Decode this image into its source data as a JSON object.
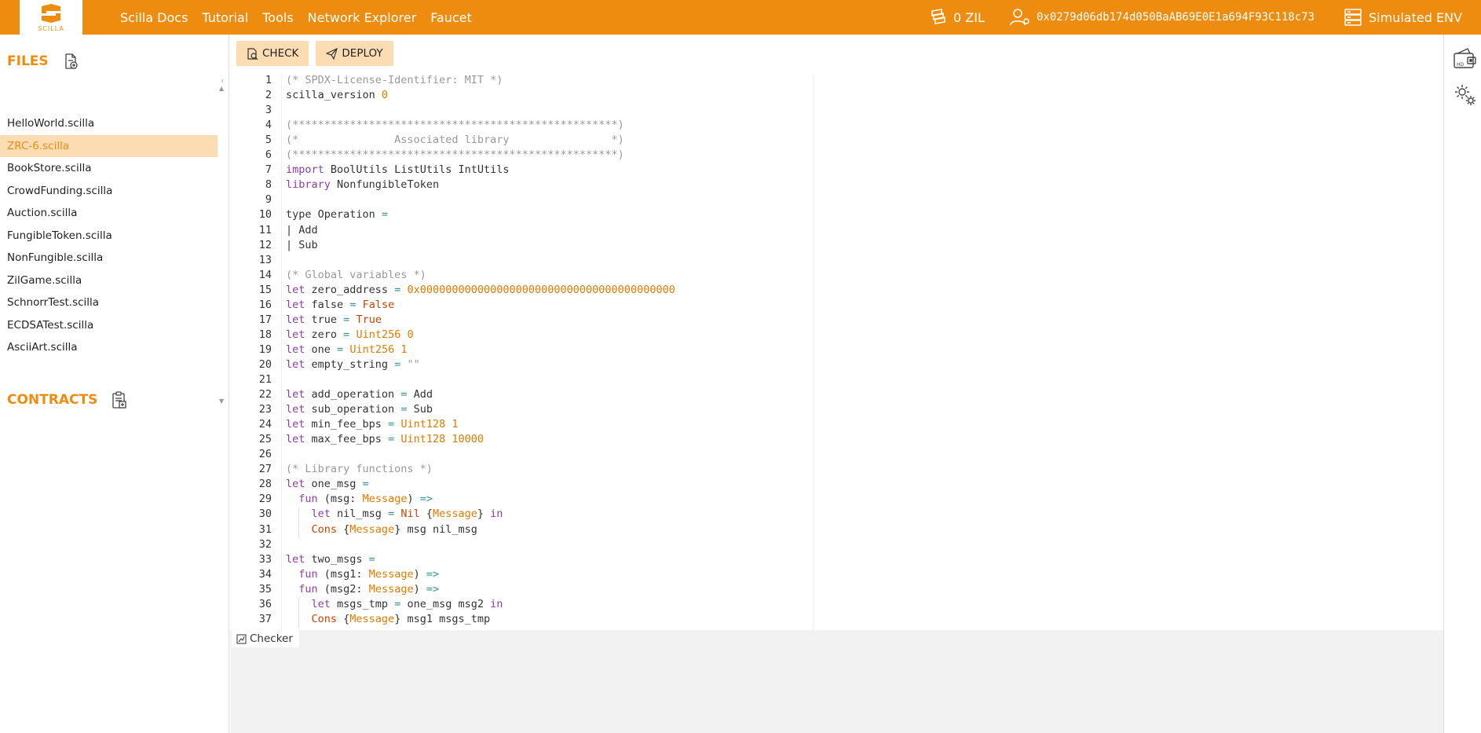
{
  "app": {
    "logo_text": "SCILLA"
  },
  "nav": {
    "items": [
      "Scilla Docs",
      "Tutorial",
      "Tools",
      "Network Explorer",
      "Faucet"
    ]
  },
  "account": {
    "balance": "0 ZIL",
    "address": "0x0279d06db174d050BaAB69E0E1a694F93C118c73",
    "env": "Simulated ENV"
  },
  "files": {
    "title": "FILES",
    "items": [
      "HelloWorld.scilla",
      "ZRC-6.scilla",
      "BookStore.scilla",
      "CrowdFunding.scilla",
      "Auction.scilla",
      "FungibleToken.scilla",
      "NonFungible.scilla",
      "ZilGame.scilla",
      "SchnorrTest.scilla",
      "ECDSATest.scilla",
      "AsciiArt.scilla"
    ],
    "active_index": 1
  },
  "contracts": {
    "title": "CONTRACTS"
  },
  "toolbar": {
    "check_label": "CHECK",
    "deploy_label": "DEPLOY"
  },
  "editor": {
    "line_numbers": [
      "1",
      "2",
      "3",
      "4",
      "5",
      "6",
      "7",
      "8",
      "9",
      "10",
      "11",
      "12",
      "13",
      "14",
      "15",
      "16",
      "17",
      "18",
      "19",
      "20",
      "21",
      "22",
      "23",
      "24",
      "25",
      "26",
      "27",
      "28",
      "29",
      "30",
      "31",
      "32",
      "33",
      "34",
      "35",
      "36",
      "37"
    ],
    "lines": [
      [
        [
          "com",
          "(* SPDX-License-Identifier: MIT *)"
        ]
      ],
      [
        [
          "txt",
          "scilla_version "
        ],
        [
          "num",
          "0"
        ]
      ],
      [],
      [
        [
          "com",
          "(***************************************************)"
        ]
      ],
      [
        [
          "com",
          "(*               Associated library                *)"
        ]
      ],
      [
        [
          "com",
          "(***************************************************)"
        ]
      ],
      [
        [
          "kw",
          "import"
        ],
        [
          "txt",
          " BoolUtils ListUtils IntUtils"
        ]
      ],
      [
        [
          "kw",
          "library"
        ],
        [
          "txt",
          " NonfungibleToken"
        ]
      ],
      [],
      [
        [
          "txt",
          "type Operation "
        ],
        [
          "op",
          "="
        ]
      ],
      [
        [
          "txt",
          "| Add"
        ]
      ],
      [
        [
          "txt",
          "| Sub"
        ]
      ],
      [],
      [
        [
          "com",
          "(* Global variables *)"
        ]
      ],
      [
        [
          "kw",
          "let"
        ],
        [
          "txt",
          " zero_address "
        ],
        [
          "op",
          "="
        ],
        [
          "txt",
          " "
        ],
        [
          "num",
          "0x0000000000000000000000000000000000000000"
        ]
      ],
      [
        [
          "kw",
          "let"
        ],
        [
          "txt",
          " false "
        ],
        [
          "op",
          "="
        ],
        [
          "txt",
          " "
        ],
        [
          "bool",
          "False"
        ]
      ],
      [
        [
          "kw",
          "let"
        ],
        [
          "txt",
          " true "
        ],
        [
          "op",
          "="
        ],
        [
          "txt",
          " "
        ],
        [
          "bool",
          "True"
        ]
      ],
      [
        [
          "kw",
          "let"
        ],
        [
          "txt",
          " zero "
        ],
        [
          "op",
          "="
        ],
        [
          "txt",
          " "
        ],
        [
          "num",
          "Uint256 0"
        ]
      ],
      [
        [
          "kw",
          "let"
        ],
        [
          "txt",
          " one "
        ],
        [
          "op",
          "="
        ],
        [
          "txt",
          " "
        ],
        [
          "num",
          "Uint256 1"
        ]
      ],
      [
        [
          "kw",
          "let"
        ],
        [
          "txt",
          " empty_string "
        ],
        [
          "op",
          "="
        ],
        [
          "txt",
          " "
        ],
        [
          "com",
          "\"\""
        ]
      ],
      [],
      [
        [
          "kw",
          "let"
        ],
        [
          "txt",
          " add_operation "
        ],
        [
          "op",
          "="
        ],
        [
          "txt",
          " Add"
        ]
      ],
      [
        [
          "kw",
          "let"
        ],
        [
          "txt",
          " sub_operation "
        ],
        [
          "op",
          "="
        ],
        [
          "txt",
          " Sub"
        ]
      ],
      [
        [
          "kw",
          "let"
        ],
        [
          "txt",
          " min_fee_bps "
        ],
        [
          "op",
          "="
        ],
        [
          "txt",
          " "
        ],
        [
          "num",
          "Uint128 1"
        ]
      ],
      [
        [
          "kw",
          "let"
        ],
        [
          "txt",
          " max_fee_bps "
        ],
        [
          "op",
          "="
        ],
        [
          "txt",
          " "
        ],
        [
          "num",
          "Uint128 10000"
        ]
      ],
      [],
      [
        [
          "com",
          "(* Library functions *)"
        ]
      ],
      [
        [
          "kw",
          "let"
        ],
        [
          "txt",
          " one_msg "
        ],
        [
          "op",
          "="
        ]
      ],
      [
        [
          "txt",
          "  "
        ],
        [
          "kw",
          "fun"
        ],
        [
          "txt",
          " (msg: "
        ],
        [
          "type",
          "Message"
        ],
        [
          "txt",
          ") "
        ],
        [
          "op",
          "=>"
        ]
      ],
      [
        [
          "txt",
          "    "
        ],
        [
          "kw",
          "let"
        ],
        [
          "txt",
          " nil_msg "
        ],
        [
          "op",
          "="
        ],
        [
          "txt",
          " "
        ],
        [
          "bool",
          "Nil"
        ],
        [
          "txt",
          " {"
        ],
        [
          "type",
          "Message"
        ],
        [
          "txt",
          "} "
        ],
        [
          "kw",
          "in"
        ]
      ],
      [
        [
          "txt",
          "    "
        ],
        [
          "bool",
          "Cons"
        ],
        [
          "txt",
          " {"
        ],
        [
          "type",
          "Message"
        ],
        [
          "txt",
          "} msg nil_msg"
        ]
      ],
      [],
      [
        [
          "kw",
          "let"
        ],
        [
          "txt",
          " two_msgs "
        ],
        [
          "op",
          "="
        ]
      ],
      [
        [
          "txt",
          "  "
        ],
        [
          "kw",
          "fun"
        ],
        [
          "txt",
          " (msg1: "
        ],
        [
          "type",
          "Message"
        ],
        [
          "txt",
          ") "
        ],
        [
          "op",
          "=>"
        ]
      ],
      [
        [
          "txt",
          "  "
        ],
        [
          "kw",
          "fun"
        ],
        [
          "txt",
          " (msg2: "
        ],
        [
          "type",
          "Message"
        ],
        [
          "txt",
          ") "
        ],
        [
          "op",
          "=>"
        ]
      ],
      [
        [
          "txt",
          "    "
        ],
        [
          "kw",
          "let"
        ],
        [
          "txt",
          " msgs_tmp "
        ],
        [
          "op",
          "="
        ],
        [
          "txt",
          " one_msg msg2 "
        ],
        [
          "kw",
          "in"
        ]
      ],
      [
        [
          "txt",
          "    "
        ],
        [
          "bool",
          "Cons"
        ],
        [
          "txt",
          " {"
        ],
        [
          "type",
          "Message"
        ],
        [
          "txt",
          "} msg1 msgs_tmp"
        ]
      ]
    ]
  },
  "bottom": {
    "checker_label": "Checker"
  },
  "colors": {
    "brand": "#ee8c10",
    "active_bg": "#fbdcb3"
  }
}
